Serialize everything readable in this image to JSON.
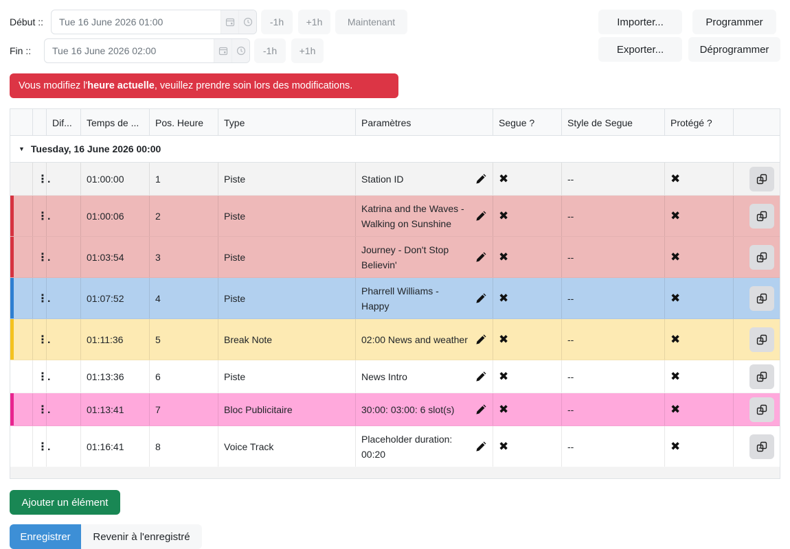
{
  "header": {
    "start_label": "Début ::",
    "start_value": "Tue 16 June 2026 01:00",
    "end_label": "Fin ::",
    "end_value": "Tue 16 June 2026 02:00",
    "minus_label": "-1h",
    "plus_label": "+1h",
    "now_label": "Maintenant",
    "import_label": "Importer...",
    "export_label": "Exporter...",
    "schedule_label": "Programmer",
    "unschedule_label": "Déprogrammer"
  },
  "alert": {
    "prefix": "Vous modifiez l'",
    "bold": "heure actuelle",
    "suffix": ", veuillez prendre soin lors des modifications."
  },
  "table": {
    "columns": [
      "",
      "",
      "Dif...",
      "Temps de ...",
      "Pos. Heure",
      "Type",
      "Paramètres",
      "Segue ?",
      "Style de Segue",
      "Protégé ?",
      ""
    ],
    "group_label": "Tuesday, 16 June 2026 00:00",
    "rows": [
      {
        "time": "01:00:00",
        "pos": "1",
        "type": "Piste",
        "params": "Station ID",
        "segue_style": "--",
        "color": "#f3f3f3",
        "stripe": ""
      },
      {
        "time": "01:00:06",
        "pos": "2",
        "type": "Piste",
        "params": "Katrina and the Waves - Walking on Sunshine",
        "segue_style": "--",
        "color": "#eeb9b9",
        "stripe": "#d63340"
      },
      {
        "time": "01:03:54",
        "pos": "3",
        "type": "Piste",
        "params": "Journey - Don't Stop Believin'",
        "segue_style": "--",
        "color": "#eeb9b9",
        "stripe": "#d63340"
      },
      {
        "time": "01:07:52",
        "pos": "4",
        "type": "Piste",
        "params": "Pharrell Williams - Happy",
        "segue_style": "--",
        "color": "#b2d0ef",
        "stripe": "#2f7fd1"
      },
      {
        "time": "01:11:36",
        "pos": "5",
        "type": "Break Note",
        "params": "02:00 News and weather",
        "segue_style": "--",
        "color": "#fdeab3",
        "stripe": "#f4c21f"
      },
      {
        "time": "01:13:36",
        "pos": "6",
        "type": "Piste",
        "params": "News Intro",
        "segue_style": "--",
        "color": "#ffffff",
        "stripe": ""
      },
      {
        "time": "01:13:41",
        "pos": "7",
        "type": "Bloc Publicitaire",
        "params": "30:00: 03:00: 6 slot(s)",
        "segue_style": "--",
        "color": "#ffa9dc",
        "stripe": "#e8258f"
      },
      {
        "time": "01:16:41",
        "pos": "8",
        "type": "Voice Track",
        "params": "Placeholder duration: 00:20",
        "segue_style": "--",
        "color": "#ffffff",
        "stripe": ""
      }
    ]
  },
  "icons": {
    "calendar": "calendar-icon",
    "clock": "clock-icon",
    "drag": "drag-handle-icon",
    "edit": "pencil-icon",
    "cross": "x-mark-icon",
    "copy": "copy-icon"
  },
  "footer": {
    "add_label": "Ajouter un élément",
    "save_label": "Enregistrer",
    "revert_label": "Revenir à l'enregistré"
  }
}
